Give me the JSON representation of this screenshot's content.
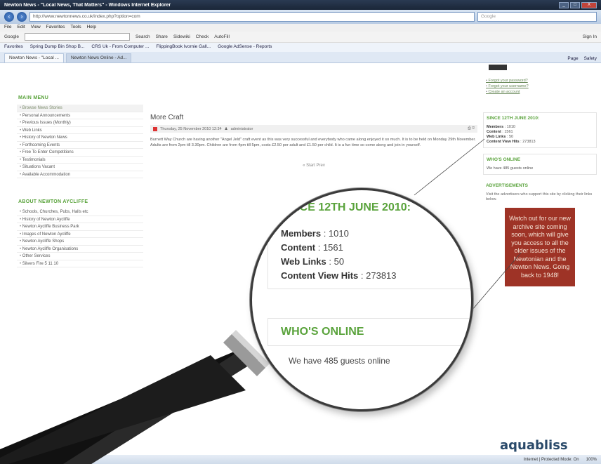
{
  "window": {
    "title": "Newton News - \"Local News, That Matters\" - Windows Internet Explorer",
    "url": "http://www.newtonnews.co.uk/index.php?option=com",
    "search_placeholder": "Google",
    "controls": [
      "_",
      "□",
      "X"
    ]
  },
  "menubar": [
    "File",
    "Edit",
    "View",
    "Favorites",
    "Tools",
    "Help"
  ],
  "google_toolbar": {
    "label": "Google",
    "items": [
      "Search",
      "Share",
      "Sidewiki",
      "Check",
      "AutoFill",
      "Sign In"
    ]
  },
  "favorites_bar": {
    "label": "Favorites",
    "items": [
      "Spring Dump Bin Shop B...",
      "CRS Uk - From Computer ...",
      "FlippingBook Ivornie Gall...",
      "Google AdSense - Reports"
    ]
  },
  "tabs": [
    {
      "label": "Newton News - \"Local ..."
    },
    {
      "label": "Newton News Online - Ad..."
    }
  ],
  "command_bar": [
    "Page",
    "Safety"
  ],
  "left_sidebar": {
    "main_menu_heading": "MAIN MENU",
    "main_menu": [
      "Browse News Stories",
      "Personal Announcements",
      "Previous Issues (Monthly)",
      "Web Links",
      "History of Newton News",
      "Forthcoming Events",
      "Free To Enter Competitions",
      "Testimonials",
      "Situations Vacant",
      "Available Accommodation"
    ],
    "about_heading": "ABOUT NEWTON AYCLIFFE",
    "about_menu": [
      "Schools, Churches, Pubs, Halls etc",
      "History of Newton Aycliffe",
      "Newton Aycliffe Business Park",
      "Images of Newton Aycliffe",
      "Newton Aycliffe Shops",
      "Newton Aycliffe Organisations",
      "Other Services",
      "Silvers Fire 5 11 10"
    ]
  },
  "article": {
    "title": "More Craft",
    "meta": "Thursday, 25 November 2010 12:34",
    "author": "administrator",
    "body": "Burnett Way Church are having another \"Angel Jeld\" craft event as this was very successful and everybody who came along enjoyed it so much. It is to be held on Monday 29th November. Adults are from 2pm till 3.30pm. Children are from 4pm till 5pm, costs £2.50 per adult and £1.50 per child. It is a fun time so come along and join in yourself.",
    "pager": "« Start   Prev"
  },
  "right_sidebar": {
    "links": [
      "Forgot your password?",
      "Forgot your username?",
      "Create an account"
    ],
    "since_heading": "SINCE 12TH JUNE 2010:",
    "stats": [
      {
        "label": "Members",
        "value": "1010"
      },
      {
        "label": "Content",
        "value": "1561"
      },
      {
        "label": "Web Links",
        "value": "50"
      },
      {
        "label": "Content View Hits",
        "value": "273813"
      }
    ],
    "online_heading": "WHO'S ONLINE",
    "online_text": "We have 485 guests online",
    "ads_heading": "ADVERTISEMENTS",
    "ads_text": "Visit the advertisers who support this site by clicking their links below.",
    "promo": "Watch out for our new archive site coming soon, which will give you access to all the older issues of the Newtonian and the Newton News. Going back to 1948!",
    "sponsor": "aquabliss"
  },
  "magnifier": {
    "since_heading": "SINCE 12TH JUNE 2010:",
    "online_heading": "WHO'S ONLINE",
    "online_text": "We have 485 guests online"
  },
  "statusbar": {
    "zone": "Internet | Protected Mode: On",
    "zoom": "100%"
  },
  "colors": {
    "accent_green": "#5aa33c",
    "promo_red": "#9e3326"
  }
}
